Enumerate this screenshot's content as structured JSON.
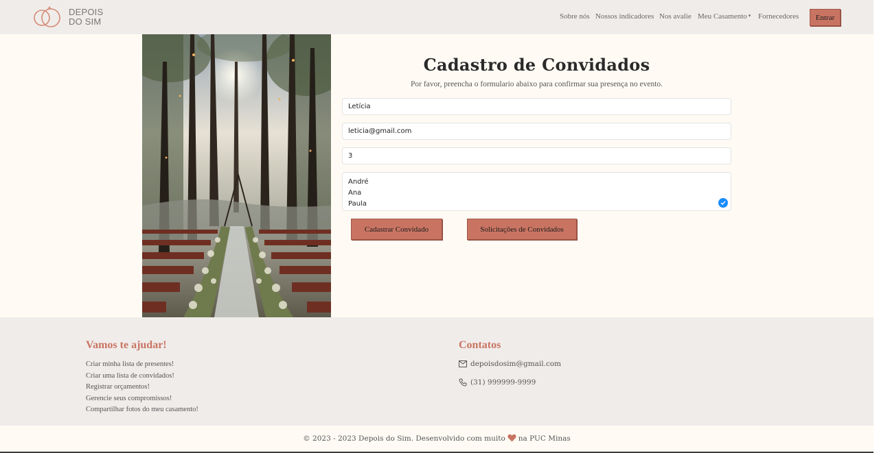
{
  "brand": {
    "line1": "DEPOIS",
    "line2": "DO SIM",
    "logo_icon": "two-rings-logo-icon"
  },
  "nav": {
    "items": [
      "Sobre nós",
      "Nossos indicadores",
      "Nos avalie",
      "Meu Casamento",
      "Fornecedores"
    ],
    "dropdown_caret": "▾",
    "login": "Entrar"
  },
  "form": {
    "title": "Cadastro de Convidados",
    "subtitle": "Por favor, preencha o formulario abaixo para confirmar sua presença no evento.",
    "name_value": "Letícia",
    "email_value": "leticia@gmail.com",
    "guests_value": "3",
    "companions": [
      "André",
      "Ana",
      "Paula"
    ],
    "submit_label": "Cadastrar Convidado",
    "requests_label": "Solicitações de Convidados"
  },
  "footer": {
    "help_title": "Vamos te ajudar!",
    "help_links": [
      "Criar minha lista de presentes!",
      "Criar uma lista de convidados!",
      "Registrar orçamentos!",
      "Gerencie seus compromissos!",
      "Compartilhar fotos do meu casamento!"
    ],
    "contacts_title": "Contatos",
    "email": "depoisdosim@gmail.com",
    "phone": "(31) 999999-9999",
    "copyright_left": "© 2023 - 2023 Depois do Sim. Desenvolvido com muito",
    "copyright_right": "na PUC Minas"
  },
  "colors": {
    "accent": "#c97462",
    "nav_bg": "#f0ecea",
    "page_bg": "#fffbf4",
    "check_blue": "#1a8cff"
  }
}
